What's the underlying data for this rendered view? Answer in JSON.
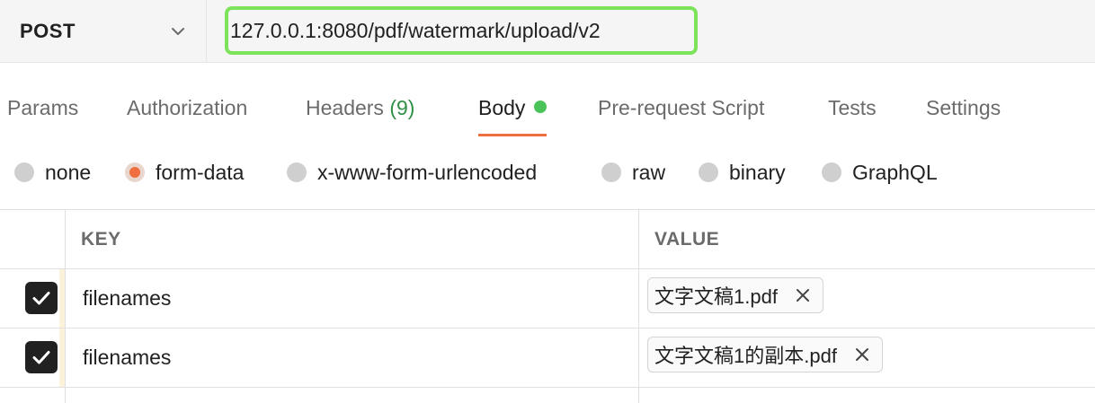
{
  "request": {
    "method": "POST",
    "url": "127.0.0.1:8080/pdf/watermark/upload/v2"
  },
  "tabs": [
    {
      "label": "Params"
    },
    {
      "label": "Authorization"
    },
    {
      "label": "Headers",
      "count": "(9)"
    },
    {
      "label": "Body",
      "active": true
    },
    {
      "label": "Pre-request Script"
    },
    {
      "label": "Tests"
    },
    {
      "label": "Settings"
    }
  ],
  "body_types": [
    {
      "label": "none"
    },
    {
      "label": "form-data",
      "selected": true
    },
    {
      "label": "x-www-form-urlencoded"
    },
    {
      "label": "raw"
    },
    {
      "label": "binary"
    },
    {
      "label": "GraphQL"
    }
  ],
  "table": {
    "headers": {
      "key": "KEY",
      "value": "VALUE"
    },
    "rows": [
      {
        "checked": true,
        "key": "filenames",
        "value": "文字文稿1.pdf"
      },
      {
        "checked": true,
        "key": "filenames",
        "value": "文字文稿1的副本.pdf"
      }
    ]
  },
  "colors": {
    "accent": "#ef6f3e",
    "url_highlight": "#7ce35a",
    "active_dot": "#4cc35a",
    "headers_count": "#2f8f46"
  },
  "icons": {
    "method_dropdown": "chevron-down-icon",
    "checkbox": "checkmark-icon",
    "remove_file": "close-icon"
  }
}
